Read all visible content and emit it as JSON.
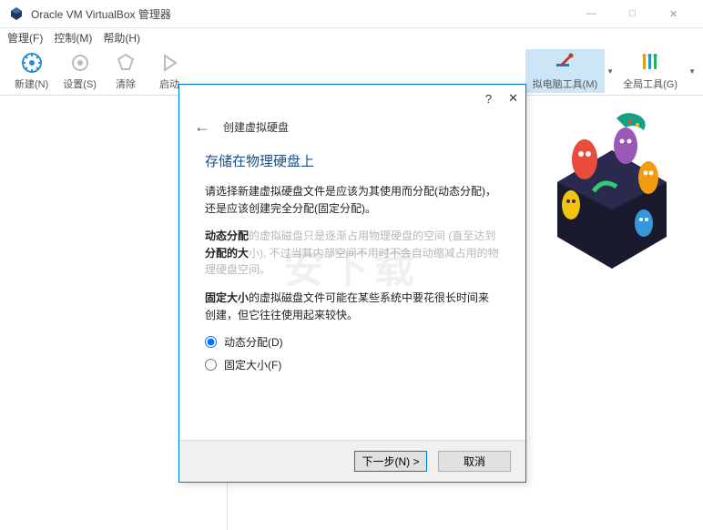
{
  "window": {
    "title": "Oracle VM VirtualBox 管理器",
    "minimize": "—",
    "maximize": "□",
    "close": "✕"
  },
  "menubar": {
    "manage": "管理(F)",
    "control": "控制(M)",
    "help": "帮助(H)"
  },
  "toolbar": {
    "new_label": "新建(N)",
    "settings_label": "设置(S)",
    "clear_label": "清除",
    "start_label": "启动",
    "vm_tools_label": "拟电脑工具(M)",
    "global_tools_label": "全局工具(G)"
  },
  "dialog": {
    "help_icon": "?",
    "close_icon": "✕",
    "back": "←",
    "header_title": "创建虚拟硬盘",
    "heading": "存储在物理硬盘上",
    "para1": "请选择新建虚拟硬盘文件是应该为其使用而分配(动态分配)，还是应该创建完全分配(固定分配)。",
    "para2_b1": "动态分配",
    "para2_mid1": "的虚拟磁盘只是逐渐占用物理硬盘的空间 (直至达到",
    "para2_b2": "分配的大",
    "para2_mid2": "小), 不过当其内部空间不用时不会自动缩减占用的物理硬盘空间。",
    "para3_b": "固定大小",
    "para3_rest": "的虚拟磁盘文件可能在某些系统中要花很长时间来创建，但它往往使用起来较快。",
    "radio_dynamic": "动态分配(D)",
    "radio_fixed": "固定大小(F)",
    "next": "下一步(N) >",
    "cancel": "取消"
  },
  "watermark": "安下载"
}
